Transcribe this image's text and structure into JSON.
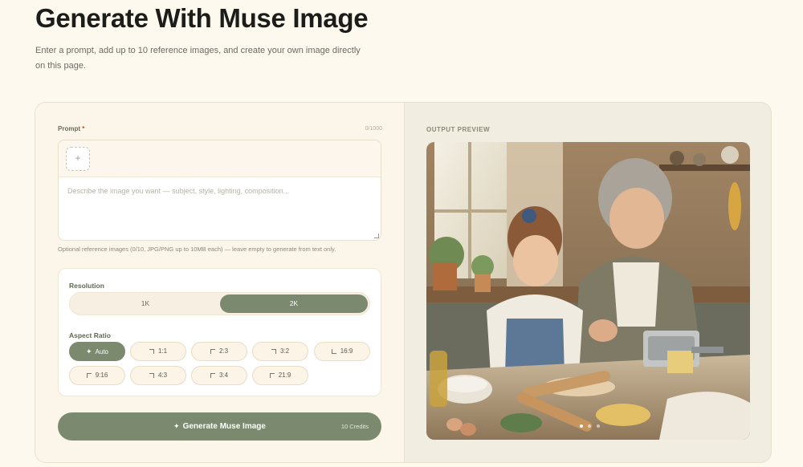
{
  "header": {
    "title": "Generate With Muse Image",
    "subtitle": "Enter a prompt, add up to 10 reference images, and create your own image directly on this page."
  },
  "prompt": {
    "label": "Prompt",
    "required_mark": "*",
    "char_count": "0/1000",
    "add_symbol": "+",
    "placeholder": "Describe the image you want — subject, style, lighting, composition...",
    "value": "",
    "reference_note": "Optional reference images (0/10, JPG/PNG up to 10MB each) — leave empty to generate from text only."
  },
  "resolution": {
    "label": "Resolution",
    "options": [
      "1K",
      "2K"
    ],
    "selected": "2K"
  },
  "aspect_ratio": {
    "label": "Aspect Ratio",
    "options": [
      "Auto",
      "1:1",
      "2:3",
      "3:2",
      "16:9",
      "9:16",
      "4:3",
      "3:4",
      "21:9"
    ],
    "selected": "Auto"
  },
  "generate": {
    "label": "Generate Muse Image",
    "credits": "10 Credits"
  },
  "output": {
    "label": "OUTPUT PREVIEW"
  },
  "colors": {
    "accent": "#7b8a6e",
    "background": "#fdf9ee",
    "required": "#b3522f"
  },
  "icons": {
    "sparkle": "✦",
    "add": "+"
  }
}
